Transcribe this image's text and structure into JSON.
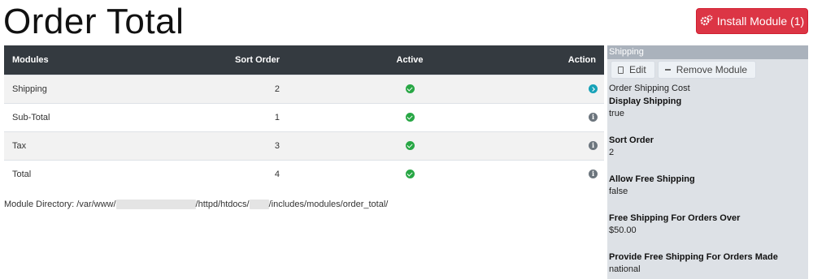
{
  "page": {
    "title": "Order Total"
  },
  "toolbar": {
    "install_label": "Install Module (1)",
    "install_color": "#dc3545"
  },
  "table": {
    "headers": {
      "modules": "Modules",
      "sort_order": "Sort Order",
      "active": "Active",
      "action": "Action"
    },
    "rows": [
      {
        "name": "Shipping",
        "sort_order": "2",
        "active_icon": "check-circle-icon",
        "action_icon": "chevron-right-circle-icon"
      },
      {
        "name": "Sub-Total",
        "sort_order": "1",
        "active_icon": "check-circle-icon",
        "action_icon": "info-circle-icon"
      },
      {
        "name": "Tax",
        "sort_order": "3",
        "active_icon": "check-circle-icon",
        "action_icon": "info-circle-icon"
      },
      {
        "name": "Total",
        "sort_order": "4",
        "active_icon": "check-circle-icon",
        "action_icon": "info-circle-icon"
      }
    ]
  },
  "directory": {
    "label": "Module Directory:",
    "part1": "/var/www/",
    "part2": "/httpd/htdocs/",
    "part3": "/includes/modules/order_total/"
  },
  "panel": {
    "heading": "Shipping",
    "edit_label": "Edit",
    "remove_label": "Remove Module",
    "description": "Order Shipping Cost",
    "settings": [
      {
        "label": "Display Shipping",
        "value": "true"
      },
      {
        "label": "Sort Order",
        "value": "2"
      },
      {
        "label": "Allow Free Shipping",
        "value": "false"
      },
      {
        "label": "Free Shipping For Orders Over",
        "value": "$50.00"
      },
      {
        "label": "Provide Free Shipping For Orders Made",
        "value": "national"
      }
    ]
  }
}
